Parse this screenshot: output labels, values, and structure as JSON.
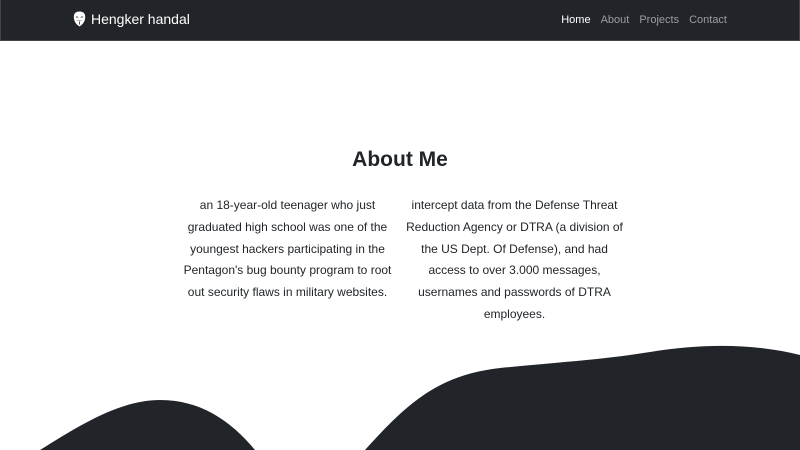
{
  "navbar": {
    "brand": "Hengker handal",
    "brand_icon": "anonymous-mask-icon",
    "links": [
      {
        "label": "Home",
        "active": true
      },
      {
        "label": "About",
        "active": false
      },
      {
        "label": "Projects",
        "active": false
      },
      {
        "label": "Contact",
        "active": false
      }
    ]
  },
  "about": {
    "title": "About Me",
    "left_text": "an 18-year-old teenager who just graduated high school was one of the youngest hackers participating in the Pentagon's bug bounty program to root out security flaws in military websites.",
    "right_text": "intercept data from the Defense Threat Reduction Agency or DTRA (a division of the US Dept. Of Defense), and had access to over 3.000 messages, usernames and passwords of DTRA employees."
  },
  "colors": {
    "navbar_bg": "#212529",
    "wave_fill": "#212529",
    "text": "#212529",
    "nav_inactive": "#9a9da0",
    "nav_active": "#ffffff"
  }
}
